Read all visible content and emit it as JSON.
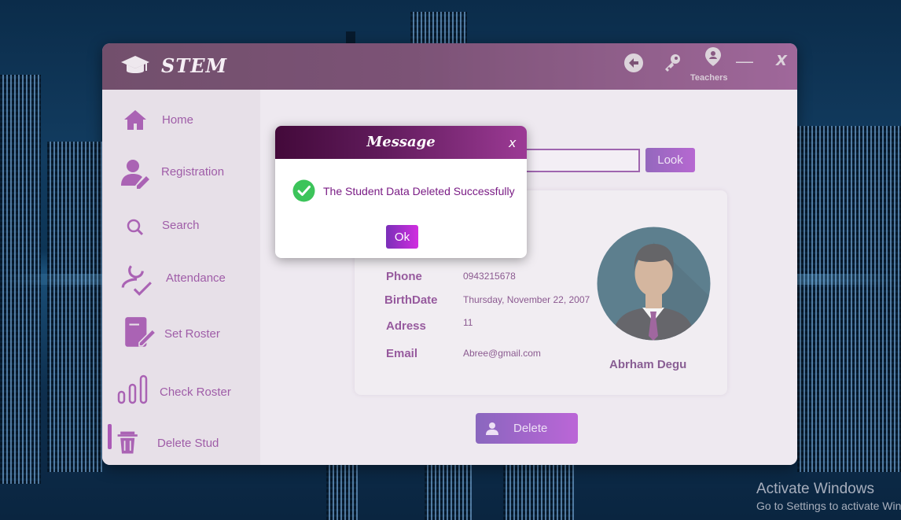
{
  "window": {
    "brand": "STEM",
    "teachers_label": "Teachers",
    "minimize": "—",
    "close": "X"
  },
  "sidebar": {
    "items": [
      {
        "label": "Home",
        "icon": "home-icon"
      },
      {
        "label": "Registration",
        "icon": "user-edit-icon"
      },
      {
        "label": "Search",
        "icon": "search-icon"
      },
      {
        "label": "Attendance",
        "icon": "attendance-icon"
      },
      {
        "label": "Set Roster",
        "icon": "clipboard-edit-icon"
      },
      {
        "label": "Check Roster",
        "icon": "bar-chart-icon"
      },
      {
        "label": "Delete Stud",
        "icon": "trash-icon"
      }
    ],
    "active": "Delete Stud"
  },
  "search": {
    "value": "",
    "look_label": "Look"
  },
  "student": {
    "fields": [
      {
        "label": "Phone",
        "value": "0943215678"
      },
      {
        "label": "BirthDate",
        "value": "Thursday, November 22, 2007"
      },
      {
        "label": "Adress",
        "value": "11"
      },
      {
        "label": "Email",
        "value": "Abree@gmail.com"
      }
    ],
    "name": "Abrham Degu"
  },
  "delete_button": {
    "label": "Delete"
  },
  "modal": {
    "title": "Message",
    "close": "x",
    "message": "The Student Data Deleted Successfully",
    "ok_label": "Ok"
  },
  "os_watermark": {
    "line1": "Activate Windows",
    "line2": "Go to Settings to activate Windows."
  },
  "colors": {
    "accent": "#7a1e86",
    "titlebar": "#4a1142",
    "success": "#3cc45a"
  }
}
